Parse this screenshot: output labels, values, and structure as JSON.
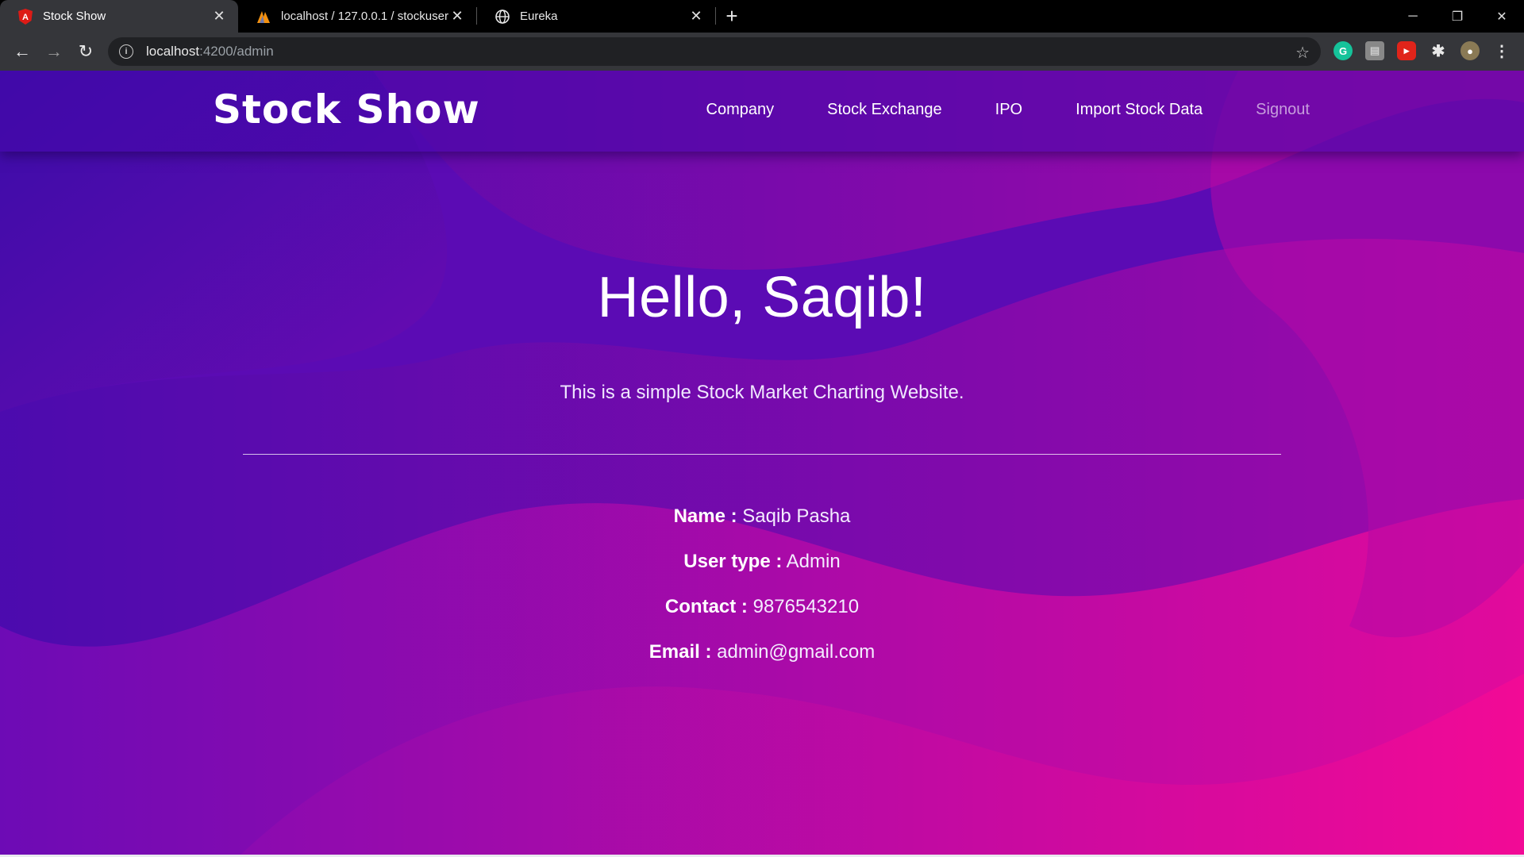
{
  "browser": {
    "tabs": [
      {
        "title": "Stock Show",
        "icon": "angular-icon",
        "active": true
      },
      {
        "title": "localhost / 127.0.0.1 / stockuser / ",
        "icon": "phpmyadmin-icon",
        "active": false
      },
      {
        "title": "Eureka",
        "icon": "globe-icon",
        "active": false
      }
    ],
    "address": {
      "host": "localhost",
      "path": ":4200/admin"
    }
  },
  "navbar": {
    "brand": "Stock Show",
    "links": [
      "Company",
      "Stock Exchange",
      "IPO",
      "Import Stock Data",
      "Signout"
    ]
  },
  "hero": {
    "greeting": "Hello, Saqib!",
    "subtitle": "This is a simple Stock Market Charting Website."
  },
  "profile": [
    {
      "label": "Name :",
      "value": "Saqib Pasha"
    },
    {
      "label": "User type :",
      "value": "Admin"
    },
    {
      "label": "Contact :",
      "value": "9876543210"
    },
    {
      "label": "Email :",
      "value": "admin@gmail.com"
    }
  ],
  "colors": {
    "gradient_start": "#3a0ca3",
    "gradient_end": "#d10aa0",
    "chrome_dark": "#35363a"
  }
}
